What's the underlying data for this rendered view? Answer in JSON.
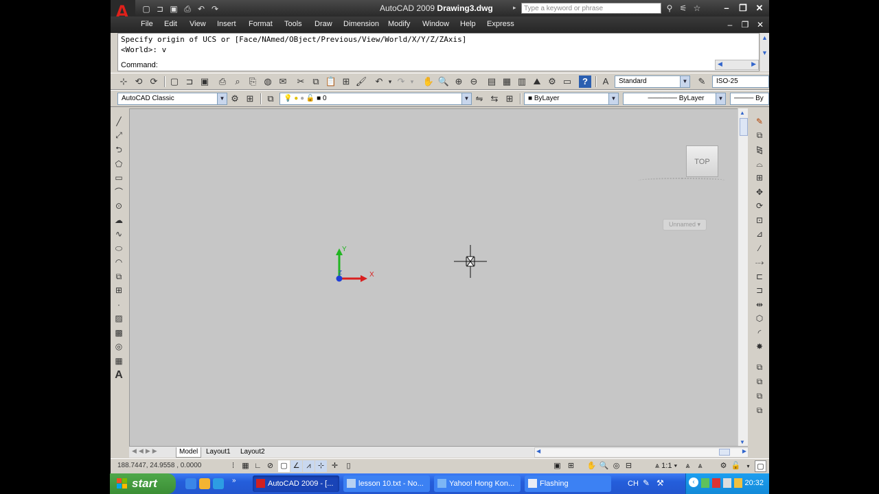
{
  "titlebar": {
    "app_name": "AutoCAD 2009",
    "doc_name": "Drawing3.dwg",
    "search_placeholder": "Type a keyword or phrase"
  },
  "menubar": {
    "items": [
      "File",
      "Edit",
      "View",
      "Insert",
      "Format",
      "Tools",
      "Draw",
      "Dimension",
      "Modify",
      "Window",
      "Help",
      "Express"
    ]
  },
  "command": {
    "line1": "Specify origin of UCS or [Face/NAmed/OBject/Previous/View/World/X/Y/Z/ZAxis]",
    "line2": "<World>: v",
    "prompt": "Command:"
  },
  "toolbar_standard": {
    "text_style": "Standard",
    "dim_style": "ISO-25"
  },
  "toolbar_layers": {
    "workspace": "AutoCAD Classic",
    "layer": "0",
    "color": "ByLayer",
    "linetype": "ByLayer",
    "lineweight": "By"
  },
  "viewport": {
    "viewcube_label": "TOP",
    "wcs_menu": "Unnamed",
    "ucs_y": "Y",
    "ucs_x": "X",
    "ucs_z": "Z"
  },
  "tabs": [
    "Model",
    "Layout1",
    "Layout2"
  ],
  "statusbar": {
    "coords": "188.7447, 24.9558 , 0.0000",
    "annotation_scale": "1:1"
  },
  "taskbar": {
    "start_label": "start",
    "tasks": [
      "AutoCAD 2009 - [...",
      "lesson 10.txt - No...",
      "Yahoo! Hong Kon...",
      "Flashing"
    ],
    "lang": "CH",
    "clock": "20:32"
  },
  "colors": {
    "title_bg": "#2a2a2a",
    "viewport_bg": "#c6c6c6",
    "taskbar_blue": "#245edb",
    "start_green": "#3b8e35",
    "ucs_x": "#d91f1f",
    "ucs_y": "#21b521",
    "ucs_z": "#1f3fd9"
  }
}
